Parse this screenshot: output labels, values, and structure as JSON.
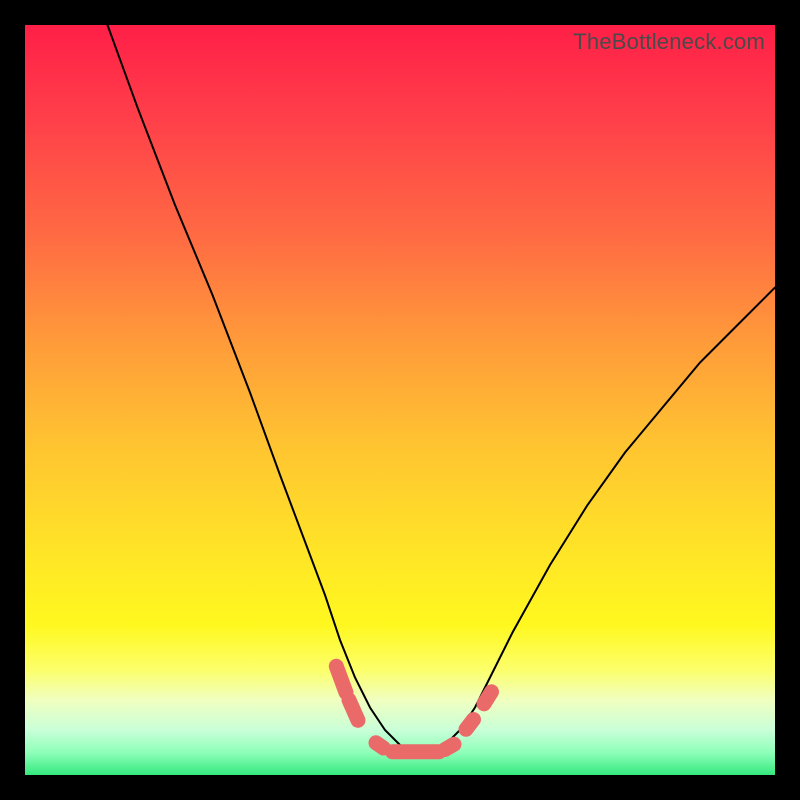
{
  "watermark": "TheBottleneck.com",
  "chart_data": {
    "type": "line",
    "title": "",
    "xlabel": "",
    "ylabel": "",
    "xlim": [
      0,
      100
    ],
    "ylim": [
      0,
      100
    ],
    "series": [
      {
        "name": "curve",
        "x": [
          11,
          15,
          20,
          25,
          30,
          34,
          37,
          40,
          42,
          44,
          46,
          48,
          50,
          52,
          54,
          56,
          58,
          60,
          62,
          65,
          70,
          75,
          80,
          85,
          90,
          95,
          100
        ],
        "y": [
          100,
          89,
          76,
          64,
          51,
          40,
          32,
          24,
          18,
          13,
          9,
          6,
          4,
          3,
          3,
          4,
          6,
          9,
          13,
          19,
          28,
          36,
          43,
          49,
          55,
          60,
          65
        ]
      }
    ],
    "markers": [
      {
        "shape": "capsule",
        "x1": 41.5,
        "y1": 14.5,
        "x2": 42.8,
        "y2": 11.0
      },
      {
        "shape": "capsule",
        "x1": 43.2,
        "y1": 10.0,
        "x2": 44.4,
        "y2": 7.3
      },
      {
        "shape": "capsule",
        "x1": 46.8,
        "y1": 4.3,
        "x2": 47.8,
        "y2": 3.6
      },
      {
        "shape": "capsule",
        "x1": 49.0,
        "y1": 3.1,
        "x2": 55.2,
        "y2": 3.1
      },
      {
        "shape": "capsule",
        "x1": 56.0,
        "y1": 3.4,
        "x2": 57.2,
        "y2": 4.1
      },
      {
        "shape": "capsule",
        "x1": 58.8,
        "y1": 6.1,
        "x2": 59.8,
        "y2": 7.4
      },
      {
        "shape": "capsule",
        "x1": 61.2,
        "y1": 9.5,
        "x2": 62.2,
        "y2": 11.1
      }
    ],
    "marker_color": "#ea6a6a",
    "curve_color": "#000000"
  }
}
